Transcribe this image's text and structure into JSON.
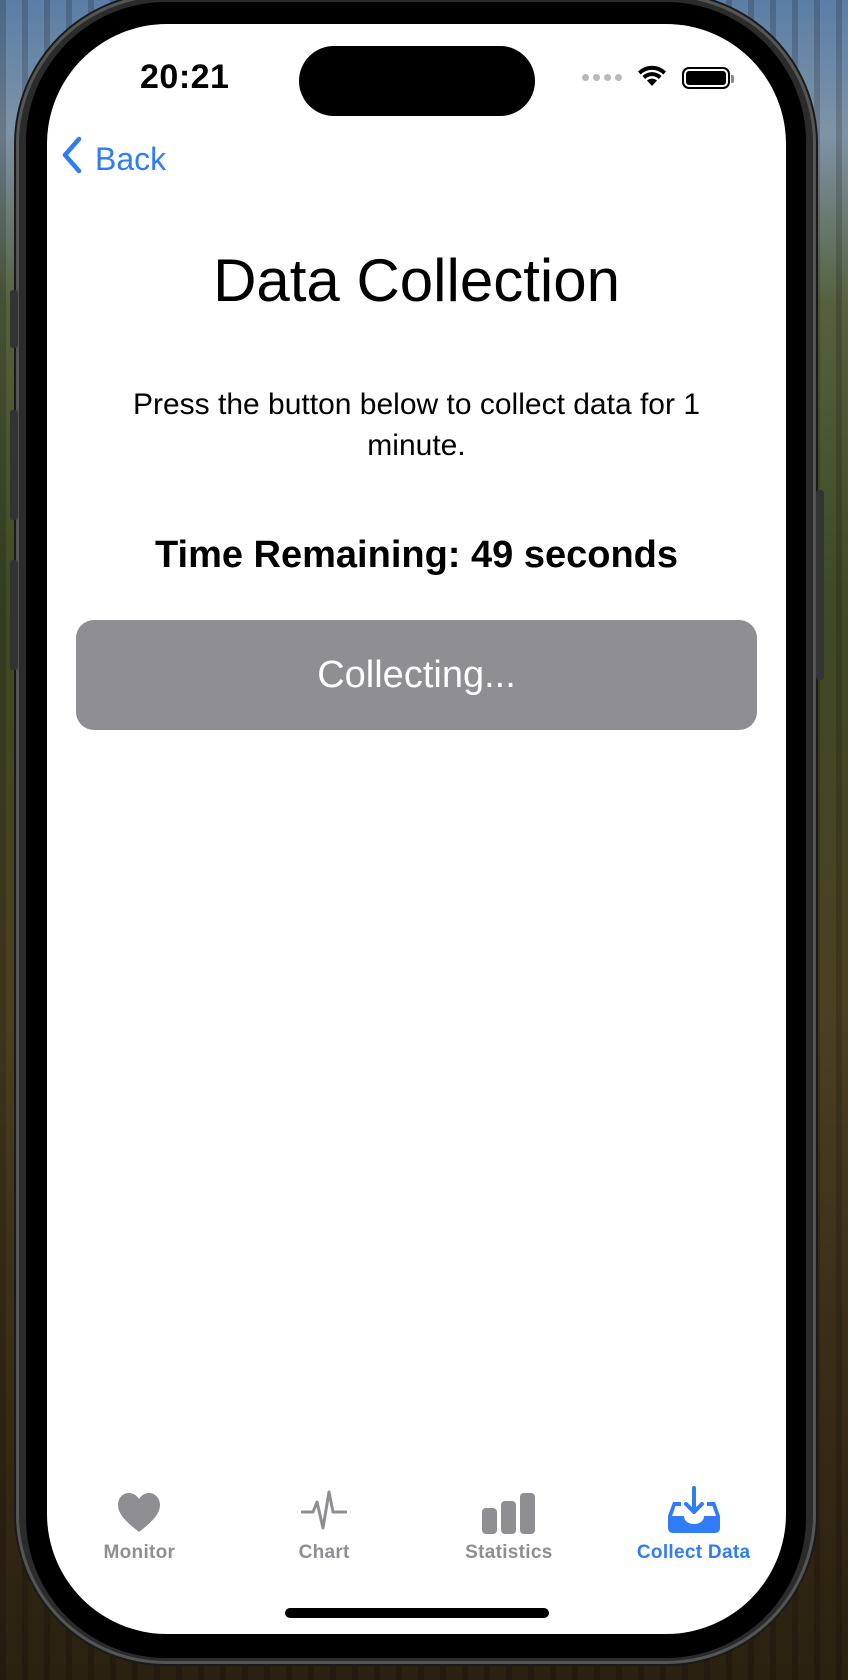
{
  "status_bar": {
    "time": "20:21"
  },
  "nav": {
    "back_label": "Back"
  },
  "main": {
    "title": "Data Collection",
    "instructions": "Press the button below to collect data for 1 minute.",
    "time_remaining": "Time Remaining: 49 seconds",
    "collect_button_label": "Collecting..."
  },
  "tabs": [
    {
      "label": "Monitor",
      "icon": "heart-icon",
      "active": false
    },
    {
      "label": "Chart",
      "icon": "waveform-icon",
      "active": false
    },
    {
      "label": "Statistics",
      "icon": "bar-chart-icon",
      "active": false
    },
    {
      "label": "Collect Data",
      "icon": "tray-download-icon",
      "active": true
    }
  ],
  "colors": {
    "accent": "#2f7cf6",
    "inactive": "#8e8e93",
    "button_disabled": "#8e8e93"
  }
}
